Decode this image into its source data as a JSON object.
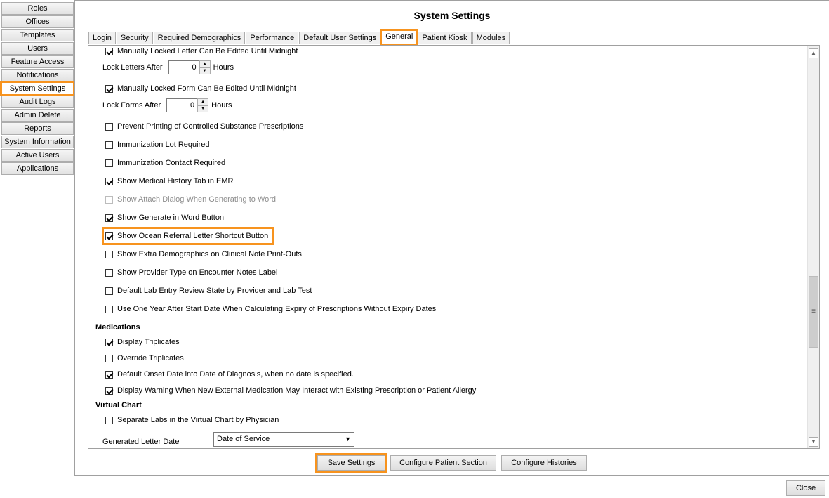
{
  "nav": {
    "items": [
      "Roles",
      "Offices",
      "Templates",
      "Users",
      "Feature Access",
      "Notifications",
      "System Settings",
      "Audit Logs",
      "Admin Delete",
      "Reports",
      "System Information",
      "Active Users",
      "Applications"
    ],
    "active": "System Settings"
  },
  "title": "System Settings",
  "tabs": [
    "Login",
    "Security",
    "Required Demographics",
    "Performance",
    "Default User Settings",
    "General",
    "Patient Kiosk",
    "Modules"
  ],
  "active_tab": "General",
  "settings": {
    "lock_letter_edit": {
      "label": "Manually Locked Letter Can Be Edited Until Midnight",
      "checked": true
    },
    "lock_letters_after": {
      "label": "Lock Letters After",
      "value": "0",
      "unit": "Hours"
    },
    "lock_form_edit": {
      "label": "Manually Locked Form Can Be Edited Until Midnight",
      "checked": true
    },
    "lock_forms_after": {
      "label": "Lock Forms After",
      "value": "0",
      "unit": "Hours"
    },
    "prevent_printing": {
      "label": "Prevent Printing of Controlled Substance Prescriptions",
      "checked": false
    },
    "immunization_lot": {
      "label": "Immunization Lot Required",
      "checked": false
    },
    "immunization_contact": {
      "label": "Immunization Contact Required",
      "checked": false
    },
    "show_medical_history": {
      "label": "Show Medical History Tab in EMR",
      "checked": true
    },
    "show_attach_dialog": {
      "label": "Show Attach Dialog When Generating to Word",
      "checked": false,
      "disabled": true
    },
    "show_generate_word": {
      "label": "Show Generate in Word Button",
      "checked": true
    },
    "show_ocean_referral": {
      "label": "Show Ocean Referral Letter Shortcut Button",
      "checked": true
    },
    "show_extra_demographics": {
      "label": "Show Extra Demographics on Clinical Note Print-Outs",
      "checked": false
    },
    "show_provider_type": {
      "label": "Show Provider Type on Encounter Notes Label",
      "checked": false
    },
    "default_lab_review": {
      "label": "Default Lab Entry Review State by Provider and Lab Test",
      "checked": false
    },
    "one_year_expiry": {
      "label": "Use One Year After Start Date When Calculating Expiry of Prescriptions Without Expiry Dates",
      "checked": false
    }
  },
  "medications": {
    "heading": "Medications",
    "display_triplicates": {
      "label": "Display Triplicates",
      "checked": true
    },
    "override_triplicates": {
      "label": "Override Triplicates",
      "checked": false
    },
    "default_onset": {
      "label": "Default Onset Date into Date of Diagnosis, when no date is specified.",
      "checked": true
    },
    "display_warning": {
      "label": "Display Warning When New External Medication May Interact with Existing Prescription or Patient Allergy",
      "checked": true
    }
  },
  "virtual_chart": {
    "heading": "Virtual Chart",
    "separate_labs": {
      "label": "Separate Labs in the Virtual Chart by Physician",
      "checked": false
    },
    "generated_letter_date_label": "Generated Letter Date",
    "generated_letter_date_value": "Date of Service"
  },
  "buttons": {
    "save": "Save Settings",
    "configure_patient": "Configure Patient Section",
    "configure_histories": "Configure Histories",
    "close": "Close"
  },
  "accent_color": "#f7931e"
}
